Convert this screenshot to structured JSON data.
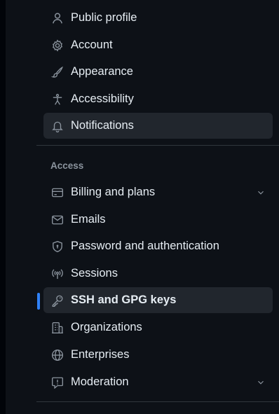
{
  "sidebar": {
    "items": [
      {
        "label": "Public profile",
        "icon": "person-icon"
      },
      {
        "label": "Account",
        "icon": "gear-icon"
      },
      {
        "label": "Appearance",
        "icon": "paintbrush-icon"
      },
      {
        "label": "Accessibility",
        "icon": "accessibility-icon"
      },
      {
        "label": "Notifications",
        "icon": "bell-icon"
      }
    ],
    "access_heading": "Access",
    "access_items": [
      {
        "label": "Billing and plans",
        "icon": "credit-card-icon",
        "expandable": true
      },
      {
        "label": "Emails",
        "icon": "mail-icon"
      },
      {
        "label": "Password and authentication",
        "icon": "shield-lock-icon"
      },
      {
        "label": "Sessions",
        "icon": "broadcast-icon"
      },
      {
        "label": "SSH and GPG keys",
        "icon": "key-icon",
        "selected": true
      },
      {
        "label": "Organizations",
        "icon": "organization-icon"
      },
      {
        "label": "Enterprises",
        "icon": "globe-icon"
      },
      {
        "label": "Moderation",
        "icon": "report-icon",
        "expandable": true
      }
    ]
  },
  "colors": {
    "background": "#0d1117",
    "text": "#e6edf3",
    "muted": "#8b949e",
    "hover_bg": "#21262d",
    "accent": "#2f81f7",
    "divider": "#30363d"
  }
}
